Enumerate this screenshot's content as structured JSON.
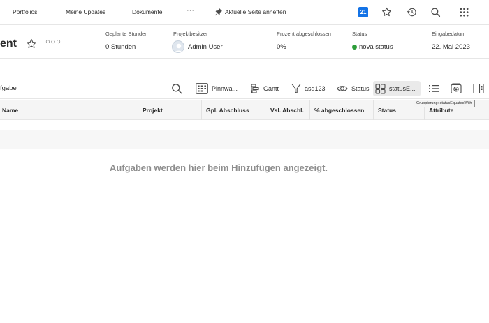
{
  "nav": {
    "items": [
      {
        "label": "Portfolios"
      },
      {
        "label": "Meine Updates"
      },
      {
        "label": "Dokumente"
      }
    ],
    "more_label": "···",
    "pin_label": "Aktuelle Seite anheften",
    "calendar_badge": "21",
    "icons": [
      "calendar-icon",
      "star-icon",
      "history-icon",
      "search-icon",
      "apps-grid-icon"
    ]
  },
  "header": {
    "title": "ent",
    "more_label": "○○○",
    "fields": {
      "planned_hours": {
        "label": "Geplante Stunden",
        "value": "0 Stunden"
      },
      "owner": {
        "label": "Projektbesitzer",
        "value": "Admin User"
      },
      "percent_complete": {
        "label": "Prozent abgeschlossen",
        "value": "0%"
      },
      "status": {
        "label": "Status",
        "value": "nova status",
        "color": "#2d9d3a"
      },
      "entry_date": {
        "label": "Eingabedatum",
        "value": "22. Mai 2023"
      }
    }
  },
  "toolbar": {
    "search_value": "fgabe",
    "buttons": {
      "board": "Pinnwa...",
      "gantt": "Gantt",
      "filter": "asd123",
      "view": "Status",
      "grouping": "statusE..."
    },
    "tooltip": "Gruppierung: statusEquatesWith"
  },
  "table": {
    "columns": {
      "name": "Name",
      "project": "Projekt",
      "planned_completion": "Gpl. Abschluss",
      "projected_completion": "Vsl. Abschl.",
      "percent_complete": "% abgeschlossen",
      "status": "Status",
      "attributes": "Attribute"
    },
    "empty_message": "Aufgaben werden hier beim Hinzufügen angezeigt."
  },
  "colors": {
    "accent": "#1473e6",
    "status_green": "#2d9d3a",
    "empty_text": "#8e8e8e"
  }
}
